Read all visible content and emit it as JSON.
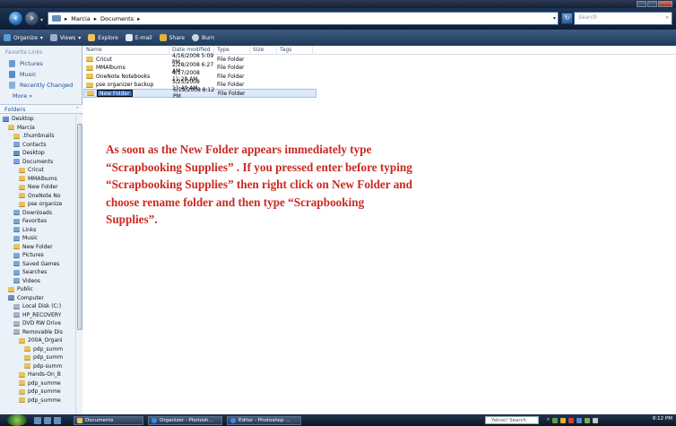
{
  "address": {
    "crumbs": [
      "Marcia",
      "Documents"
    ],
    "separator": "▸"
  },
  "search": {
    "placeholder": "Search"
  },
  "toolbar": {
    "organize": "Organize",
    "views": "Views",
    "explore": "Explore",
    "email": "E-mail",
    "share": "Share",
    "burn": "Burn"
  },
  "nav": {
    "favorites_header": "Favorite Links",
    "favorites": [
      "Pictures",
      "Music",
      "Recently Changed"
    ],
    "more": "More",
    "folders_header": "Folders",
    "tree": [
      {
        "label": "Desktop",
        "indent": 0,
        "icon": "dk"
      },
      {
        "label": "Marcia",
        "indent": 1,
        "icon": "fd"
      },
      {
        "label": ".thumbnails",
        "indent": 2,
        "icon": "fd"
      },
      {
        "label": "Contacts",
        "indent": 2,
        "icon": "bl"
      },
      {
        "label": "Desktop",
        "indent": 2,
        "icon": "dk"
      },
      {
        "label": "Documents",
        "indent": 2,
        "icon": "bl"
      },
      {
        "label": "Cricut",
        "indent": 3,
        "icon": "fd"
      },
      {
        "label": "MMAlbums",
        "indent": 3,
        "icon": "fd"
      },
      {
        "label": "New Folder",
        "indent": 3,
        "icon": "fd"
      },
      {
        "label": "OneNote No",
        "indent": 3,
        "icon": "fd"
      },
      {
        "label": "pse organize",
        "indent": 3,
        "icon": "fd"
      },
      {
        "label": "Downloads",
        "indent": 2,
        "icon": "bl"
      },
      {
        "label": "Favorites",
        "indent": 2,
        "icon": "bl"
      },
      {
        "label": "Links",
        "indent": 2,
        "icon": "bl"
      },
      {
        "label": "Music",
        "indent": 2,
        "icon": "bl"
      },
      {
        "label": "New Folder",
        "indent": 2,
        "icon": "fd"
      },
      {
        "label": "Pictures",
        "indent": 2,
        "icon": "bl"
      },
      {
        "label": "Saved Games",
        "indent": 2,
        "icon": "bl"
      },
      {
        "label": "Searches",
        "indent": 2,
        "icon": "bl"
      },
      {
        "label": "Videos",
        "indent": 2,
        "icon": "bl"
      },
      {
        "label": "Public",
        "indent": 1,
        "icon": "fd"
      },
      {
        "label": "Computer",
        "indent": 1,
        "icon": "dk"
      },
      {
        "label": "Local Disk (C:)",
        "indent": 2,
        "icon": "gr"
      },
      {
        "label": "HP_RECOVERY",
        "indent": 2,
        "icon": "gr"
      },
      {
        "label": "DVD RW Drive",
        "indent": 2,
        "icon": "gr"
      },
      {
        "label": "Removable Dis",
        "indent": 2,
        "icon": "gr"
      },
      {
        "label": "200A_Organi",
        "indent": 3,
        "icon": "fd"
      },
      {
        "label": "pdp_summ",
        "indent": 4,
        "icon": "fd"
      },
      {
        "label": "pdp_summ",
        "indent": 4,
        "icon": "fd"
      },
      {
        "label": "pdp-summ",
        "indent": 4,
        "icon": "fd"
      },
      {
        "label": "Hands-On_B",
        "indent": 3,
        "icon": "fd"
      },
      {
        "label": "pdp_summe",
        "indent": 3,
        "icon": "fd"
      },
      {
        "label": "pdp_summe",
        "indent": 3,
        "icon": "fd"
      },
      {
        "label": "pdp_summe",
        "indent": 3,
        "icon": "fd"
      }
    ]
  },
  "filelist": {
    "columns": [
      "Name",
      "Date modified",
      "Type",
      "Size",
      "Tags"
    ],
    "rows": [
      {
        "name": "Cricut",
        "date": "4/16/2008 5:09 PM",
        "type": "File Folder"
      },
      {
        "name": "MMAlbums",
        "date": "2/28/2008 6:27 AM",
        "type": "File Folder"
      },
      {
        "name": "OneNote Notebooks",
        "date": "4/17/2008 11:28 AM",
        "type": "File Folder"
      },
      {
        "name": "pse organizer backup",
        "date": "5/25/2008 11:49 AM",
        "type": "File Folder"
      },
      {
        "name": "New Folder",
        "date": "6/19/2008 8:12 PM",
        "type": "File Folder",
        "renaming": true
      }
    ]
  },
  "instruction": "As soon as the New Folder appears immediately type “Scrapbooking Supplies” . If you pressed enter before typing “Scrapbooking Supplies” then right click on New Folder and choose rename folder and then type “Scrapbooking Supplies”.",
  "taskbar": {
    "tasks": [
      "Documents",
      "Organizer - Photosh...",
      "Editor - Photoshop ..."
    ],
    "yahoo": "Yahoo! Search",
    "clock": "8:12 PM"
  }
}
